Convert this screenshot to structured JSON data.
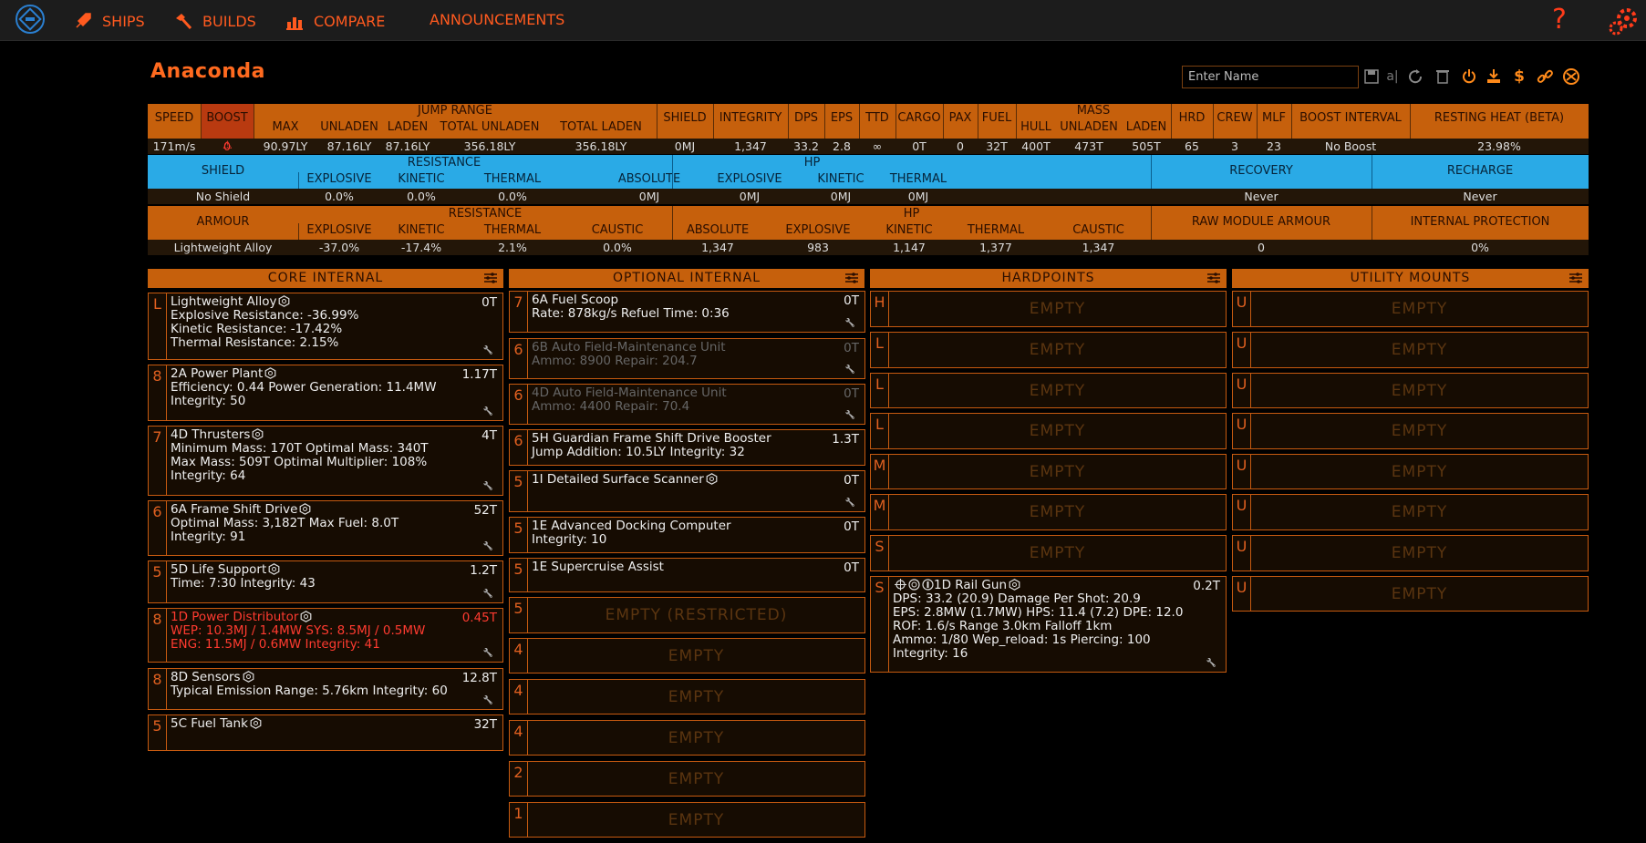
{
  "nav": {
    "ships": "SHIPS",
    "builds": "BUILDS",
    "compare": "COMPARE",
    "announcements": "ANNOUNCEMENTS",
    "help": "?"
  },
  "ship": {
    "name": "Anaconda",
    "name_placeholder": "Enter Name"
  },
  "toolbar": {
    "icons": [
      "save-icon",
      "undo-icon",
      "reload-icon",
      "delete-icon",
      "power-icon",
      "export-icon",
      "cost-icon",
      "link-icon",
      "coriolis-icon"
    ],
    "undo_glyph": "a|",
    "cost_glyph": "$"
  },
  "stats": {
    "headers": {
      "speed": "SPEED",
      "boost": "BOOST",
      "jump_range": "JUMP RANGE",
      "max": "MAX",
      "unladen": "UNLADEN",
      "laden": "LADEN",
      "total_unladen": "TOTAL UNLADEN",
      "total_laden": "TOTAL LADEN",
      "shield": "SHIELD",
      "integrity": "INTEGRITY",
      "dps": "DPS",
      "eps": "EPS",
      "ttd": "TTD",
      "cargo": "CARGO",
      "pax": "PAX",
      "fuel": "FUEL",
      "mass": "MASS",
      "hull": "HULL",
      "m_unladen": "UNLADEN",
      "m_laden": "LADEN",
      "hrd": "HRD",
      "crew": "CREW",
      "mlf": "MLF",
      "boost_interval": "BOOST INTERVAL",
      "resting_heat": "RESTING HEAT (BETA)"
    },
    "values": {
      "speed": "171m/s",
      "boost": "0",
      "max": "90.97LY",
      "unladen": "87.16LY",
      "laden": "87.16LY",
      "total_unladen": "356.18LY",
      "total_laden": "356.18LY",
      "shield": "0MJ",
      "integrity": "1,347",
      "dps": "33.2",
      "eps": "2.8",
      "ttd": "∞",
      "cargo": "0T",
      "pax": "0",
      "fuel": "32T",
      "hull": "400T",
      "m_unladen": "473T",
      "m_laden": "505T",
      "hrd": "65",
      "crew": "3",
      "mlf": "23",
      "boost_interval": "No Boost",
      "resting_heat": "23.98%"
    }
  },
  "shield_row": {
    "headers": {
      "shield": "SHIELD",
      "resistance": "RESISTANCE",
      "explosive": "EXPLOSIVE",
      "kinetic": "KINETIC",
      "thermal": "THERMAL",
      "hp": "HP",
      "absolute": "ABSOLUTE",
      "hp_explosive": "EXPLOSIVE",
      "hp_kinetic": "KINETIC",
      "hp_thermal": "THERMAL",
      "recovery": "RECOVERY",
      "recharge": "RECHARGE"
    },
    "values": {
      "shield": "No Shield",
      "explosive": "0.0%",
      "kinetic": "0.0%",
      "thermal": "0.0%",
      "absolute": "0MJ",
      "hp_explosive": "0MJ",
      "hp_kinetic": "0MJ",
      "hp_thermal": "0MJ",
      "recovery": "Never",
      "recharge": "Never"
    }
  },
  "armour_row": {
    "headers": {
      "armour": "ARMOUR",
      "resistance": "RESISTANCE",
      "explosive": "EXPLOSIVE",
      "kinetic": "KINETIC",
      "thermal": "THERMAL",
      "caustic": "CAUSTIC",
      "hp": "HP",
      "absolute": "ABSOLUTE",
      "hp_explosive": "EXPLOSIVE",
      "hp_kinetic": "KINETIC",
      "hp_thermal": "THERMAL",
      "hp_caustic": "CAUSTIC",
      "raw": "RAW MODULE ARMOUR",
      "internal": "INTERNAL PROTECTION"
    },
    "values": {
      "armour": "Lightweight Alloy",
      "explosive": "-37.0%",
      "kinetic": "-17.4%",
      "thermal": "2.1%",
      "caustic": "0.0%",
      "absolute": "1,347",
      "hp_explosive": "983",
      "hp_kinetic": "1,147",
      "hp_thermal": "1,377",
      "hp_caustic": "1,347",
      "raw": "0",
      "internal": "0%"
    }
  },
  "sections": {
    "core": "CORE INTERNAL",
    "optional": "OPTIONAL INTERNAL",
    "hardpoints": "HARDPOINTS",
    "utility": "UTILITY MOUNTS"
  },
  "core": [
    {
      "cls": "L",
      "name": "Lightweight Alloy",
      "mass": "0T",
      "lines": [
        "Explosive Resistance: -36.99%",
        "Kinetic Resistance: -17.42%",
        "Thermal Resistance: 2.15%"
      ]
    },
    {
      "cls": "8",
      "name": "2A Power Plant",
      "mass": "1.17T",
      "lines": [
        "Efficiency: 0.44   Power Generation: 11.4MW",
        "Integrity: 50"
      ]
    },
    {
      "cls": "7",
      "name": "4D Thrusters",
      "mass": "4T",
      "lines": [
        "Minimum Mass: 170T   Optimal Mass: 340T",
        "Max Mass: 509T   Optimal Multiplier: 108%",
        "Integrity: 64"
      ]
    },
    {
      "cls": "6",
      "name": "6A Frame Shift Drive",
      "mass": "52T",
      "lines": [
        "Optimal Mass: 3,182T   Max Fuel: 8.0T",
        "Integrity: 91"
      ]
    },
    {
      "cls": "5",
      "name": "5D Life Support",
      "mass": "1.2T",
      "lines": [
        "Time: 7:30   Integrity: 43"
      ]
    },
    {
      "cls": "8",
      "name": "1D Power Distributor",
      "mass": "0.45T",
      "lines": [
        "WEP: 10.3MJ / 1.4MW   SYS: 8.5MJ / 0.5MW",
        "ENG: 11.5MJ / 0.6MW   Integrity: 41"
      ]
    },
    {
      "cls": "8",
      "name": "8D Sensors",
      "mass": "12.8T",
      "lines": [
        "Typical Emission Range: 5.76km   Integrity: 60"
      ]
    },
    {
      "cls": "5",
      "name": "5C Fuel Tank",
      "mass": "32T",
      "lines": []
    }
  ],
  "optional": [
    {
      "cls": "7",
      "name": "6A Fuel Scoop",
      "mass": "0T",
      "lines": [
        "Rate: 878kg/s   Refuel Time: 0:36"
      ]
    },
    {
      "cls": "6",
      "name": "6B Auto Field-Maintenance Unit",
      "mass": "0T",
      "lines": [
        "Ammo: 8900   Repair: 204.7"
      ]
    },
    {
      "cls": "6",
      "name": "4D Auto Field-Maintenance Unit",
      "mass": "0T",
      "lines": [
        "Ammo: 4400   Repair: 70.4"
      ]
    },
    {
      "cls": "6",
      "name": "5H Guardian Frame Shift Drive Booster",
      "mass": "1.3T",
      "lines": [
        "Jump Addition: 10.5LY   Integrity: 32"
      ]
    },
    {
      "cls": "5",
      "name": "1I Detailed Surface Scanner",
      "mass": "0T",
      "lines": []
    },
    {
      "cls": "5",
      "name": "1E Advanced Docking Computer",
      "mass": "0T",
      "lines": [
        "Integrity: 10"
      ]
    },
    {
      "cls": "5",
      "name": "1E Supercruise Assist",
      "mass": "0T",
      "lines": []
    },
    {
      "cls": "5",
      "empty": "EMPTY (RESTRICTED)"
    },
    {
      "cls": "4",
      "empty": "EMPTY"
    },
    {
      "cls": "4",
      "empty": "EMPTY"
    },
    {
      "cls": "4",
      "empty": "EMPTY"
    },
    {
      "cls": "2",
      "empty": "EMPTY"
    },
    {
      "cls": "1",
      "empty": "EMPTY"
    }
  ],
  "hardpoints": [
    {
      "cls": "H",
      "empty": "EMPTY"
    },
    {
      "cls": "L",
      "empty": "EMPTY"
    },
    {
      "cls": "L",
      "empty": "EMPTY"
    },
    {
      "cls": "L",
      "empty": "EMPTY"
    },
    {
      "cls": "M",
      "empty": "EMPTY"
    },
    {
      "cls": "M",
      "empty": "EMPTY"
    },
    {
      "cls": "S",
      "empty": "EMPTY"
    },
    {
      "cls": "S",
      "name": "1D Rail Gun",
      "mass": "0.2T",
      "lines": [
        "DPS: 33.2 (20.9)   Damage Per Shot: 20.9",
        "EPS: 2.8MW (1.7MW)   HPS: 11.4 (7.2)   DPE: 12.0",
        "ROF: 1.6/s   Range 3.0km   Falloff 1km",
        "Ammo: 1/80   Wep_reload: 1s   Piercing: 100",
        "Integrity: 16"
      ]
    }
  ],
  "utility": [
    {
      "cls": "U",
      "empty": "EMPTY"
    },
    {
      "cls": "U",
      "empty": "EMPTY"
    },
    {
      "cls": "U",
      "empty": "EMPTY"
    },
    {
      "cls": "U",
      "empty": "EMPTY"
    },
    {
      "cls": "U",
      "empty": "EMPTY"
    },
    {
      "cls": "U",
      "empty": "EMPTY"
    },
    {
      "cls": "U",
      "empty": "EMPTY"
    },
    {
      "cls": "U",
      "empty": "EMPTY"
    }
  ]
}
